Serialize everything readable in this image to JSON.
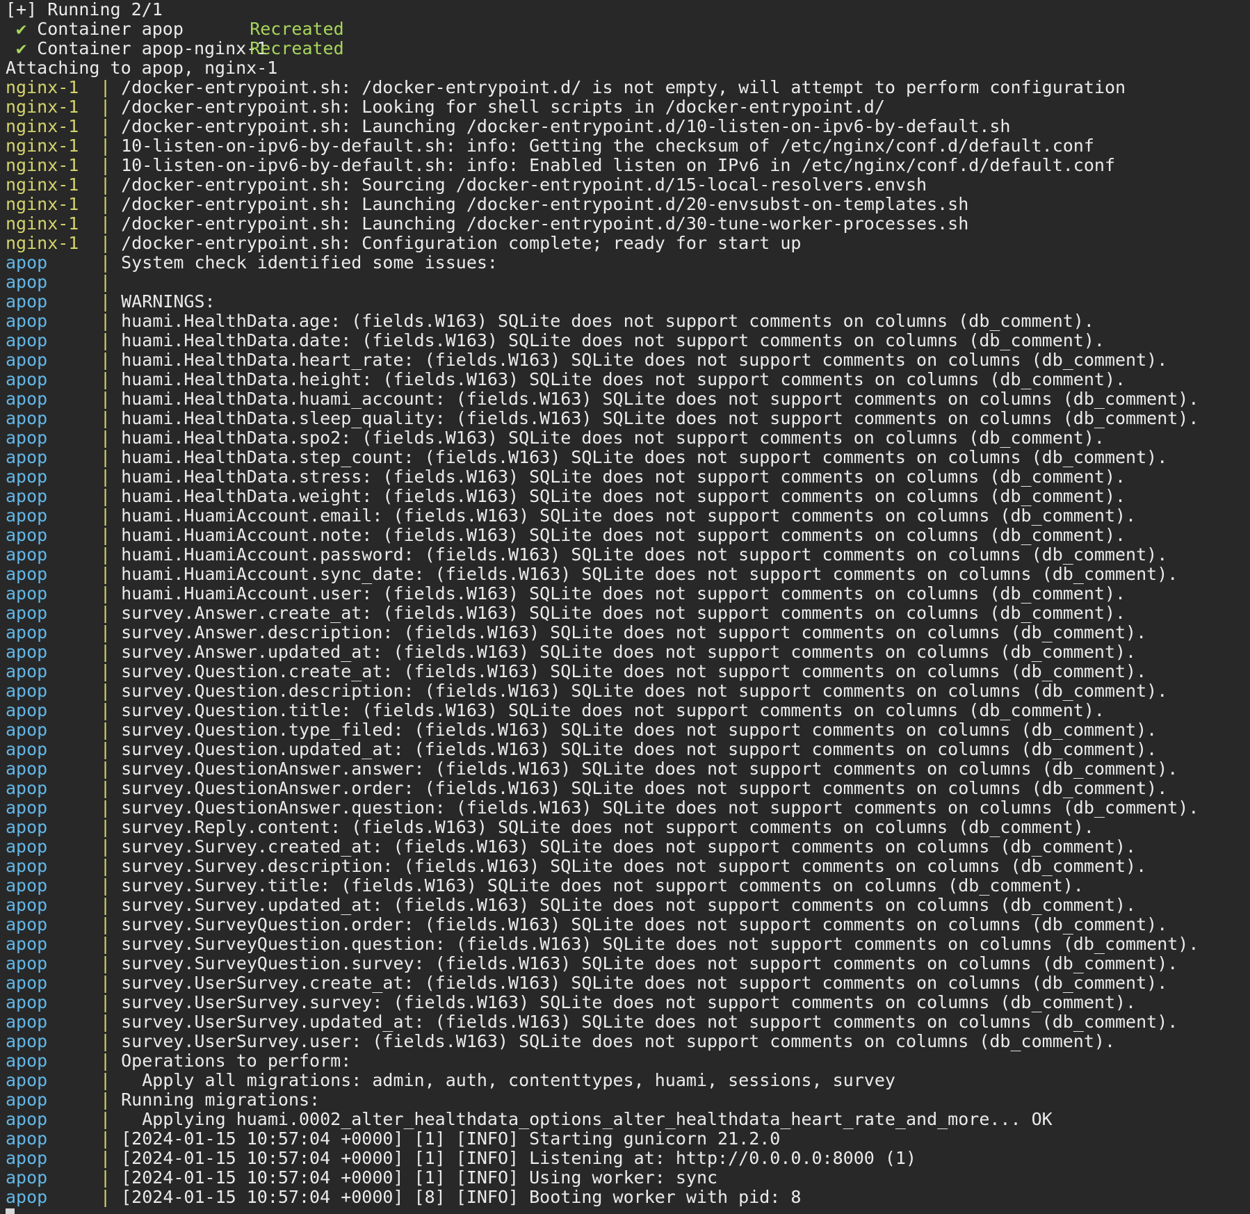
{
  "colors": {
    "background": "#282828",
    "text": "#ebebeb",
    "nginx_prefix": "#d4d46c",
    "apop_prefix": "#63b7e8",
    "status_ok": "#a8d65c"
  },
  "header": {
    "running": "[+] Running 2/1",
    "containers": [
      {
        "check": "✔",
        "name": "Container apop",
        "status": "Recreated"
      },
      {
        "check": "✔",
        "name": "Container apop-nginx-1",
        "status": "Recreated"
      }
    ],
    "attaching": "Attaching to apop, nginx-1"
  },
  "separator": "|",
  "nginx_lines": [
    {
      "service": "nginx-1",
      "message": "/docker-entrypoint.sh: /docker-entrypoint.d/ is not empty, will attempt to perform configuration"
    },
    {
      "service": "nginx-1",
      "message": "/docker-entrypoint.sh: Looking for shell scripts in /docker-entrypoint.d/"
    },
    {
      "service": "nginx-1",
      "message": "/docker-entrypoint.sh: Launching /docker-entrypoint.d/10-listen-on-ipv6-by-default.sh"
    },
    {
      "service": "nginx-1",
      "message": "10-listen-on-ipv6-by-default.sh: info: Getting the checksum of /etc/nginx/conf.d/default.conf"
    },
    {
      "service": "nginx-1",
      "message": "10-listen-on-ipv6-by-default.sh: info: Enabled listen on IPv6 in /etc/nginx/conf.d/default.conf"
    },
    {
      "service": "nginx-1",
      "message": "/docker-entrypoint.sh: Sourcing /docker-entrypoint.d/15-local-resolvers.envsh"
    },
    {
      "service": "nginx-1",
      "message": "/docker-entrypoint.sh: Launching /docker-entrypoint.d/20-envsubst-on-templates.sh"
    },
    {
      "service": "nginx-1",
      "message": "/docker-entrypoint.sh: Launching /docker-entrypoint.d/30-tune-worker-processes.sh"
    },
    {
      "service": "nginx-1",
      "message": "/docker-entrypoint.sh: Configuration complete; ready for start up"
    }
  ],
  "apop_lines": [
    {
      "service": "apop",
      "message": "System check identified some issues:"
    },
    {
      "service": "apop",
      "message": ""
    },
    {
      "service": "apop",
      "message": "WARNINGS:"
    },
    {
      "service": "apop",
      "message": "huami.HealthData.age: (fields.W163) SQLite does not support comments on columns (db_comment)."
    },
    {
      "service": "apop",
      "message": "huami.HealthData.date: (fields.W163) SQLite does not support comments on columns (db_comment)."
    },
    {
      "service": "apop",
      "message": "huami.HealthData.heart_rate: (fields.W163) SQLite does not support comments on columns (db_comment)."
    },
    {
      "service": "apop",
      "message": "huami.HealthData.height: (fields.W163) SQLite does not support comments on columns (db_comment)."
    },
    {
      "service": "apop",
      "message": "huami.HealthData.huami_account: (fields.W163) SQLite does not support comments on columns (db_comment)."
    },
    {
      "service": "apop",
      "message": "huami.HealthData.sleep_quality: (fields.W163) SQLite does not support comments on columns (db_comment)."
    },
    {
      "service": "apop",
      "message": "huami.HealthData.spo2: (fields.W163) SQLite does not support comments on columns (db_comment)."
    },
    {
      "service": "apop",
      "message": "huami.HealthData.step_count: (fields.W163) SQLite does not support comments on columns (db_comment)."
    },
    {
      "service": "apop",
      "message": "huami.HealthData.stress: (fields.W163) SQLite does not support comments on columns (db_comment)."
    },
    {
      "service": "apop",
      "message": "huami.HealthData.weight: (fields.W163) SQLite does not support comments on columns (db_comment)."
    },
    {
      "service": "apop",
      "message": "huami.HuamiAccount.email: (fields.W163) SQLite does not support comments on columns (db_comment)."
    },
    {
      "service": "apop",
      "message": "huami.HuamiAccount.note: (fields.W163) SQLite does not support comments on columns (db_comment)."
    },
    {
      "service": "apop",
      "message": "huami.HuamiAccount.password: (fields.W163) SQLite does not support comments on columns (db_comment)."
    },
    {
      "service": "apop",
      "message": "huami.HuamiAccount.sync_date: (fields.W163) SQLite does not support comments on columns (db_comment)."
    },
    {
      "service": "apop",
      "message": "huami.HuamiAccount.user: (fields.W163) SQLite does not support comments on columns (db_comment)."
    },
    {
      "service": "apop",
      "message": "survey.Answer.create_at: (fields.W163) SQLite does not support comments on columns (db_comment)."
    },
    {
      "service": "apop",
      "message": "survey.Answer.description: (fields.W163) SQLite does not support comments on columns (db_comment)."
    },
    {
      "service": "apop",
      "message": "survey.Answer.updated_at: (fields.W163) SQLite does not support comments on columns (db_comment)."
    },
    {
      "service": "apop",
      "message": "survey.Question.create_at: (fields.W163) SQLite does not support comments on columns (db_comment)."
    },
    {
      "service": "apop",
      "message": "survey.Question.description: (fields.W163) SQLite does not support comments on columns (db_comment)."
    },
    {
      "service": "apop",
      "message": "survey.Question.title: (fields.W163) SQLite does not support comments on columns (db_comment)."
    },
    {
      "service": "apop",
      "message": "survey.Question.type_filed: (fields.W163) SQLite does not support comments on columns (db_comment)."
    },
    {
      "service": "apop",
      "message": "survey.Question.updated_at: (fields.W163) SQLite does not support comments on columns (db_comment)."
    },
    {
      "service": "apop",
      "message": "survey.QuestionAnswer.answer: (fields.W163) SQLite does not support comments on columns (db_comment)."
    },
    {
      "service": "apop",
      "message": "survey.QuestionAnswer.order: (fields.W163) SQLite does not support comments on columns (db_comment)."
    },
    {
      "service": "apop",
      "message": "survey.QuestionAnswer.question: (fields.W163) SQLite does not support comments on columns (db_comment)."
    },
    {
      "service": "apop",
      "message": "survey.Reply.content: (fields.W163) SQLite does not support comments on columns (db_comment)."
    },
    {
      "service": "apop",
      "message": "survey.Survey.created_at: (fields.W163) SQLite does not support comments on columns (db_comment)."
    },
    {
      "service": "apop",
      "message": "survey.Survey.description: (fields.W163) SQLite does not support comments on columns (db_comment)."
    },
    {
      "service": "apop",
      "message": "survey.Survey.title: (fields.W163) SQLite does not support comments on columns (db_comment)."
    },
    {
      "service": "apop",
      "message": "survey.Survey.updated_at: (fields.W163) SQLite does not support comments on columns (db_comment)."
    },
    {
      "service": "apop",
      "message": "survey.SurveyQuestion.order: (fields.W163) SQLite does not support comments on columns (db_comment)."
    },
    {
      "service": "apop",
      "message": "survey.SurveyQuestion.question: (fields.W163) SQLite does not support comments on columns (db_comment)."
    },
    {
      "service": "apop",
      "message": "survey.SurveyQuestion.survey: (fields.W163) SQLite does not support comments on columns (db_comment)."
    },
    {
      "service": "apop",
      "message": "survey.UserSurvey.create_at: (fields.W163) SQLite does not support comments on columns (db_comment)."
    },
    {
      "service": "apop",
      "message": "survey.UserSurvey.survey: (fields.W163) SQLite does not support comments on columns (db_comment)."
    },
    {
      "service": "apop",
      "message": "survey.UserSurvey.updated_at: (fields.W163) SQLite does not support comments on columns (db_comment)."
    },
    {
      "service": "apop",
      "message": "survey.UserSurvey.user: (fields.W163) SQLite does not support comments on columns (db_comment)."
    },
    {
      "service": "apop",
      "message": "Operations to perform:"
    },
    {
      "service": "apop",
      "message": "  Apply all migrations: admin, auth, contenttypes, huami, sessions, survey"
    },
    {
      "service": "apop",
      "message": "Running migrations:"
    },
    {
      "service": "apop",
      "message": "  Applying huami.0002_alter_healthdata_options_alter_healthdata_heart_rate_and_more... OK"
    },
    {
      "service": "apop",
      "message": "[2024-01-15 10:57:04 +0000] [1] [INFO] Starting gunicorn 21.2.0"
    },
    {
      "service": "apop",
      "message": "[2024-01-15 10:57:04 +0000] [1] [INFO] Listening at: http://0.0.0.0:8000 (1)"
    },
    {
      "service": "apop",
      "message": "[2024-01-15 10:57:04 +0000] [1] [INFO] Using worker: sync"
    },
    {
      "service": "apop",
      "message": "[2024-01-15 10:57:04 +0000] [8] [INFO] Booting worker with pid: 8"
    }
  ]
}
